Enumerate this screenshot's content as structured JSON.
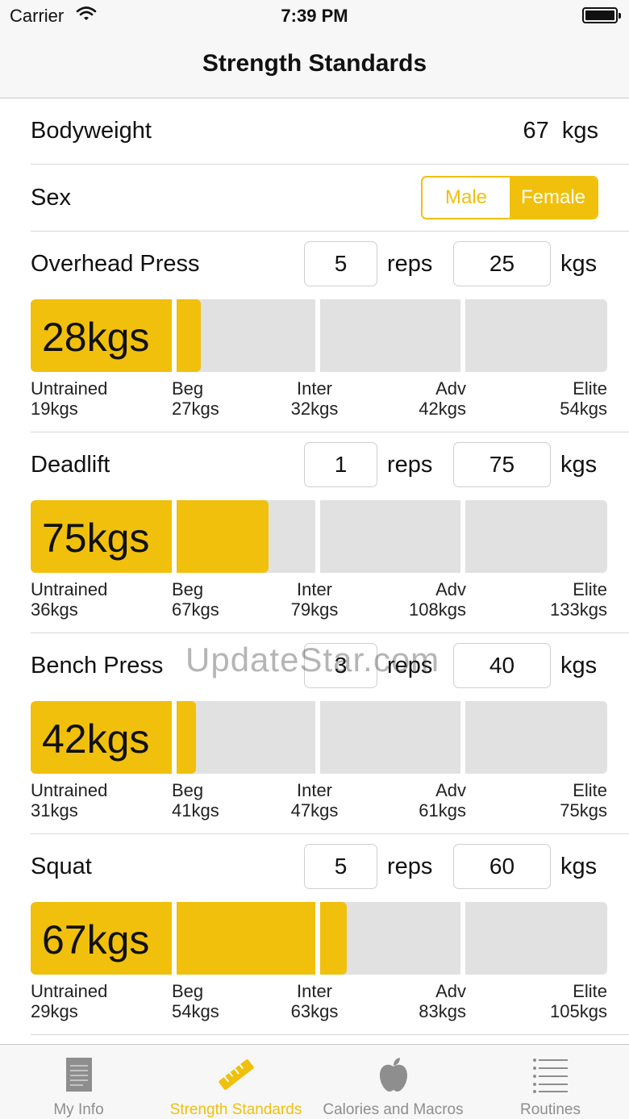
{
  "status_bar": {
    "carrier": "Carrier",
    "time": "7:39 PM"
  },
  "nav": {
    "title": "Strength Standards"
  },
  "bodyweight": {
    "label": "Bodyweight",
    "value": "67",
    "unit": "kgs"
  },
  "sex": {
    "label": "Sex",
    "options": [
      "Male",
      "Female"
    ],
    "selected": "Female"
  },
  "exercises": [
    {
      "name": "Overhead Press",
      "reps": "5",
      "reps_unit": "reps",
      "weight": "25",
      "weight_unit": "kgs",
      "result": "28kgs",
      "fill_fraction": 0.295,
      "levels": [
        {
          "name": "Untrained",
          "value": "19kgs"
        },
        {
          "name": "Beg",
          "value": "27kgs"
        },
        {
          "name": "Inter",
          "value": "32kgs"
        },
        {
          "name": "Adv",
          "value": "42kgs"
        },
        {
          "name": "Elite",
          "value": "54kgs"
        }
      ]
    },
    {
      "name": "Deadlift",
      "reps": "1",
      "reps_unit": "reps",
      "weight": "75",
      "weight_unit": "kgs",
      "result": "75kgs",
      "fill_fraction": 0.412,
      "levels": [
        {
          "name": "Untrained",
          "value": "36kgs"
        },
        {
          "name": "Beg",
          "value": "67kgs"
        },
        {
          "name": "Inter",
          "value": "79kgs"
        },
        {
          "name": "Adv",
          "value": "108kgs"
        },
        {
          "name": "Elite",
          "value": "133kgs"
        }
      ]
    },
    {
      "name": "Bench Press",
      "reps": "3",
      "reps_unit": "reps",
      "weight": "40",
      "weight_unit": "kgs",
      "result": "42kgs",
      "fill_fraction": 0.287,
      "levels": [
        {
          "name": "Untrained",
          "value": "31kgs"
        },
        {
          "name": "Beg",
          "value": "41kgs"
        },
        {
          "name": "Inter",
          "value": "47kgs"
        },
        {
          "name": "Adv",
          "value": "61kgs"
        },
        {
          "name": "Elite",
          "value": "75kgs"
        }
      ]
    },
    {
      "name": "Squat",
      "reps": "5",
      "reps_unit": "reps",
      "weight": "60",
      "weight_unit": "kgs",
      "result": "67kgs",
      "fill_fraction": 0.548,
      "levels": [
        {
          "name": "Untrained",
          "value": "29kgs"
        },
        {
          "name": "Beg",
          "value": "54kgs"
        },
        {
          "name": "Inter",
          "value": "63kgs"
        },
        {
          "name": "Adv",
          "value": "83kgs"
        },
        {
          "name": "Elite",
          "value": "105kgs"
        }
      ]
    }
  ],
  "watermark": "UpdateStar.com",
  "tabs": [
    {
      "label": "My Info",
      "icon": "document-icon",
      "active": false
    },
    {
      "label": "Strength Standards",
      "icon": "ruler-icon",
      "active": true
    },
    {
      "label": "Calories and Macros",
      "icon": "apple-icon",
      "active": false
    },
    {
      "label": "Routines",
      "icon": "list-icon",
      "active": false
    }
  ],
  "colors": {
    "accent": "#f0c00c",
    "bar_bg": "#e1e1e1",
    "tab_inactive": "#8e8e8e"
  }
}
